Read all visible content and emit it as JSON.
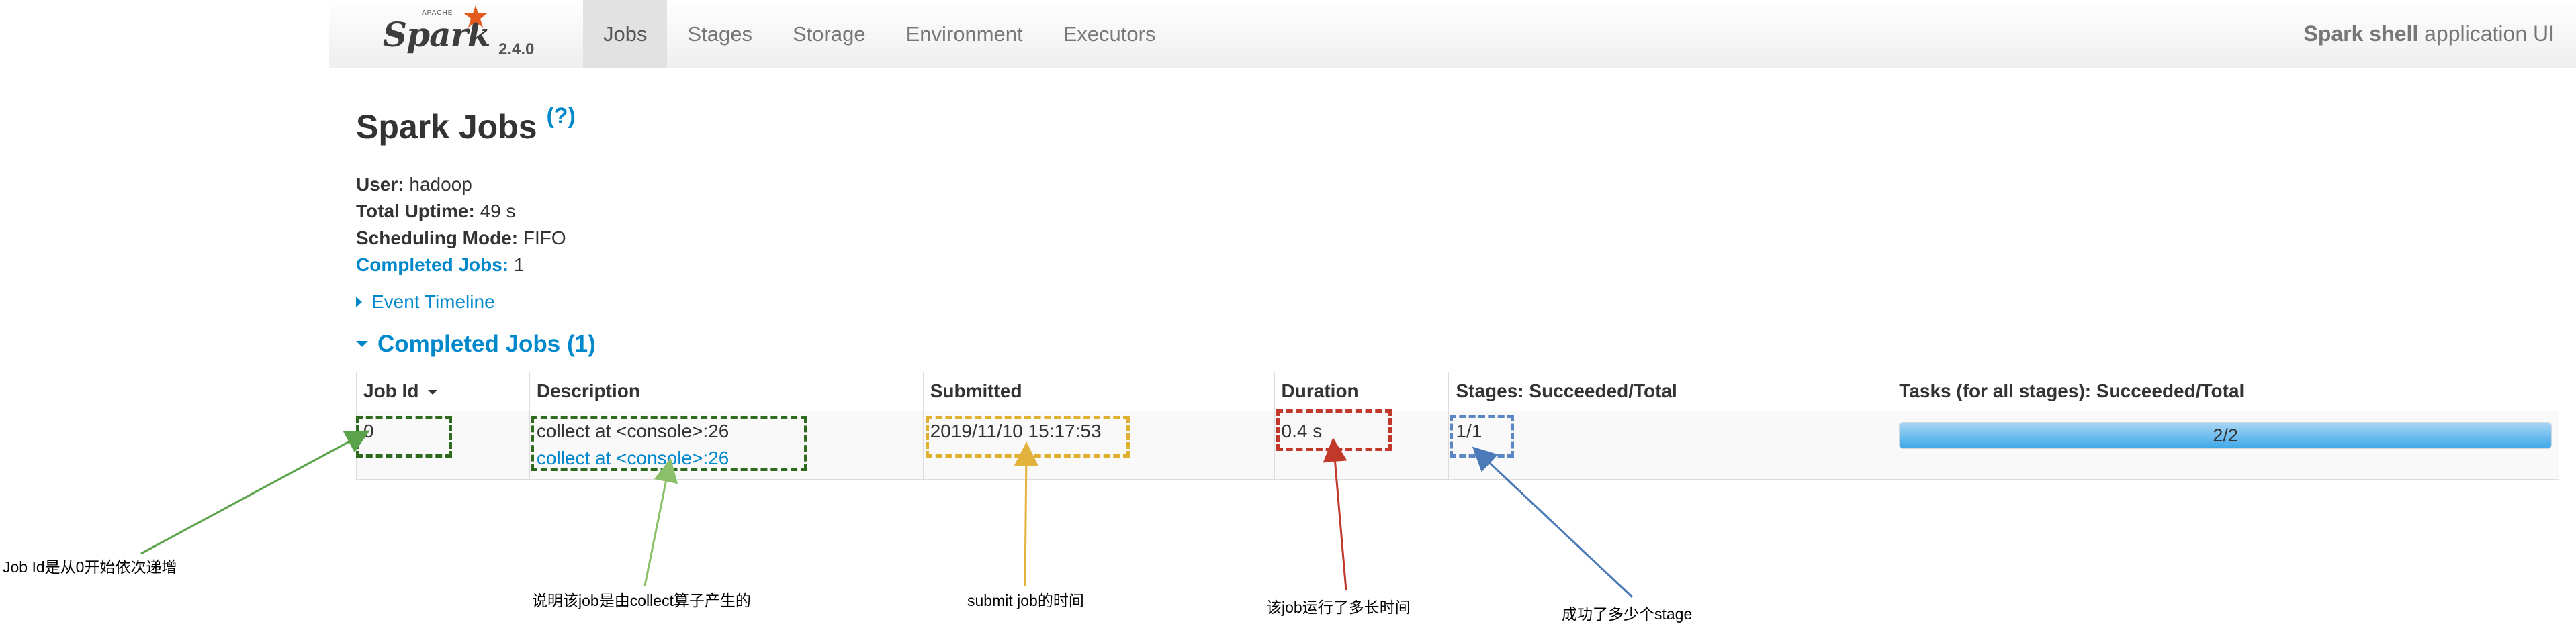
{
  "navbar": {
    "brand": {
      "apache": "APACHE",
      "name": "Spark",
      "version": "2.4.0"
    },
    "tabs": [
      {
        "label": "Jobs",
        "active": true
      },
      {
        "label": "Stages",
        "active": false
      },
      {
        "label": "Storage",
        "active": false
      },
      {
        "label": "Environment",
        "active": false
      },
      {
        "label": "Executors",
        "active": false
      }
    ],
    "app_name": "Spark shell",
    "app_suffix": " application UI"
  },
  "page": {
    "title": "Spark Jobs",
    "help": "(?)",
    "summary": {
      "user_label": "User:",
      "user": " hadoop",
      "uptime_label": "Total Uptime:",
      "uptime": " 49 s",
      "mode_label": "Scheduling Mode:",
      "mode": " FIFO",
      "completed_label": "Completed Jobs:",
      "completed": " 1"
    },
    "event_timeline": "Event Timeline",
    "section_title": "Completed Jobs (1)"
  },
  "table": {
    "headers": [
      "Job Id",
      "Description",
      "Submitted",
      "Duration",
      "Stages: Succeeded/Total",
      "Tasks (for all stages): Succeeded/Total"
    ],
    "rows": [
      {
        "job_id": "0",
        "description": "collect at <console>:26",
        "description_link": "collect at <console>:26",
        "submitted": "2019/11/10 15:17:53",
        "duration": "0.4 s",
        "stages": "1/1",
        "tasks": "2/2",
        "tasks_fraction": 1.0
      }
    ]
  },
  "annotations": [
    {
      "text": "Job Id是从0开始依次递增",
      "color": "#5aa34a"
    },
    {
      "text": "说明该job是由collect算子产生的",
      "color": "#8bbf6a"
    },
    {
      "text": "submit job的时间",
      "color": "#e3b23c"
    },
    {
      "text": "该job运行了多长时间",
      "color": "#c0392b"
    },
    {
      "text": "成功了多少个stage",
      "color": "#4a7ab8"
    }
  ],
  "colors": {
    "link": "#0088cc",
    "box_green": "#2e6b1f",
    "box_yellow": "#e0b030",
    "box_red": "#c0392b",
    "box_blue": "#5b86c4"
  }
}
